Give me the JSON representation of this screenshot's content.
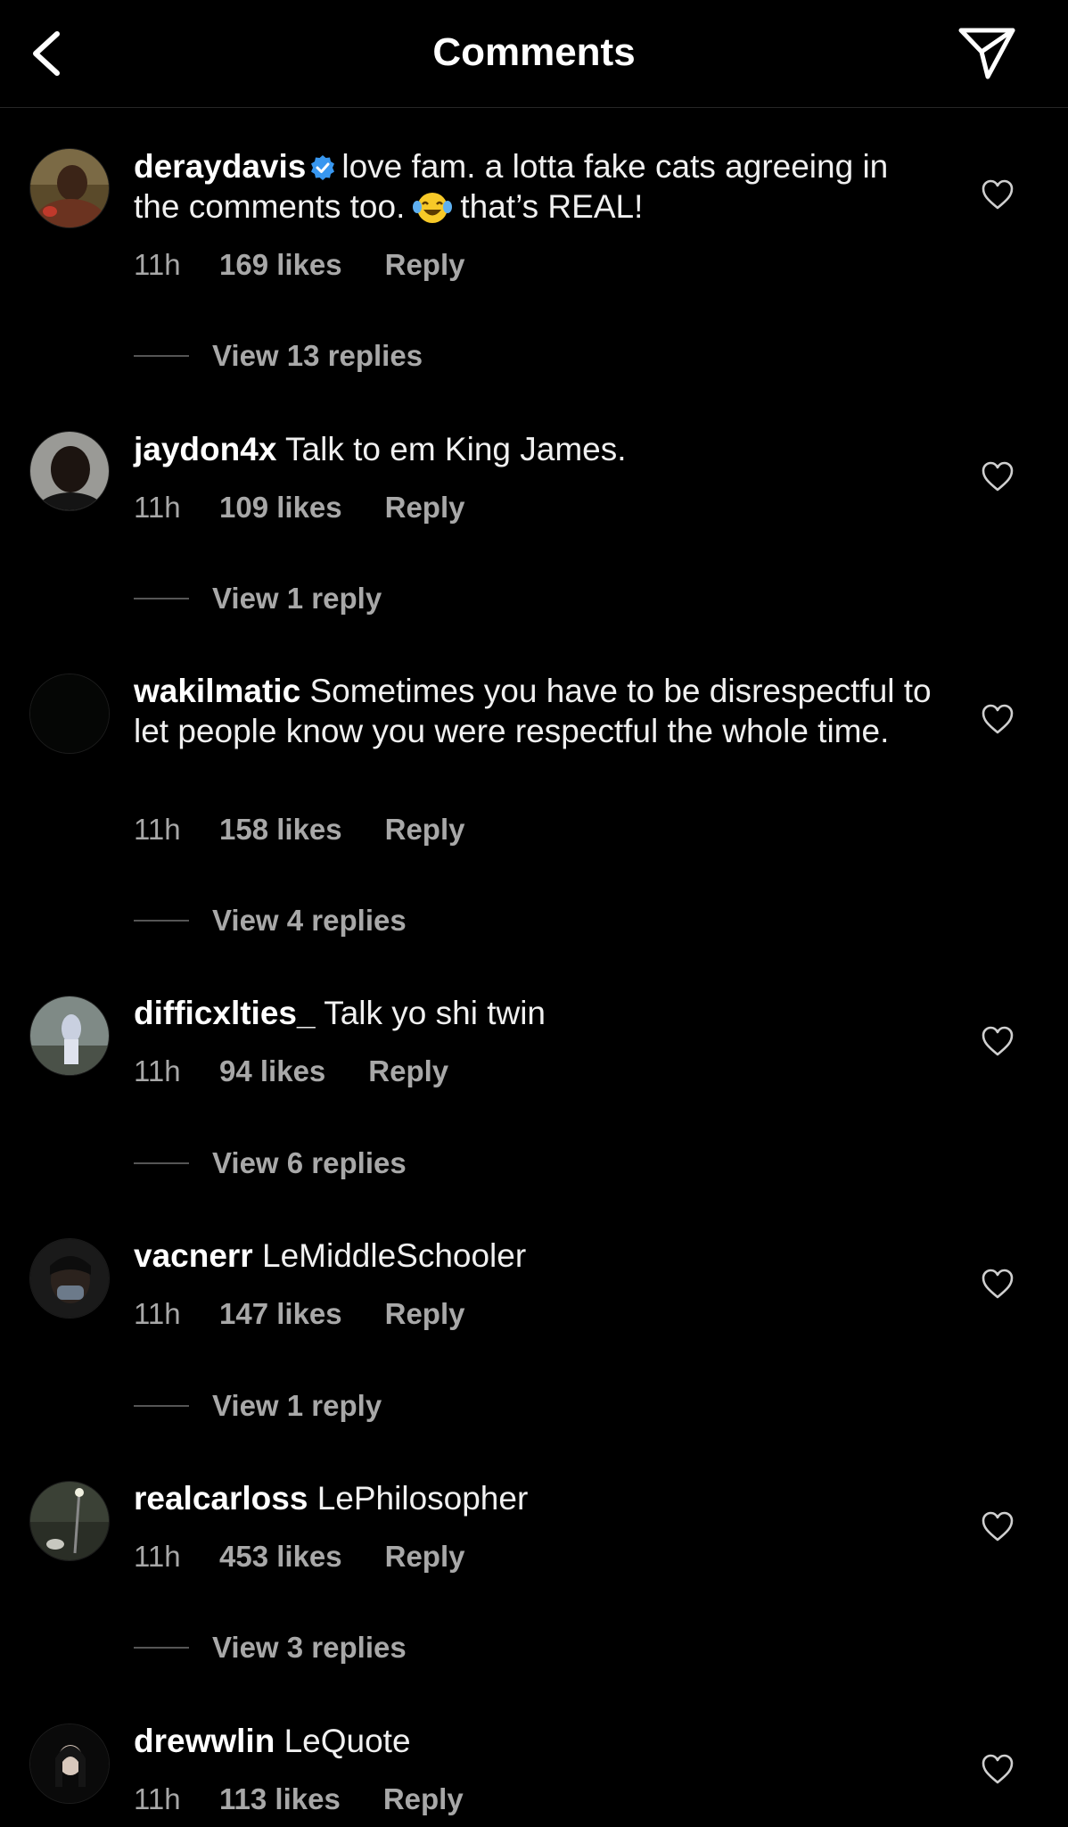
{
  "header": {
    "title": "Comments",
    "back_icon": "chevron-left-icon",
    "share_icon": "paper-plane-icon"
  },
  "colors": {
    "background": "#000000",
    "text_primary": "#ffffff",
    "text_secondary": "#a8a8a8",
    "verified": "#3897f0"
  },
  "comments": [
    {
      "username": "deraydavis",
      "verified": true,
      "text_before_emoji": "love fam. a lotta fake cats agreeing in the comments too.",
      "emoji": "face-with-tears-of-joy",
      "text_after_emoji": "that’s REAL!",
      "time": "11h",
      "likes": "169 likes",
      "reply_label": "Reply",
      "view_replies": "View 13 replies"
    },
    {
      "username": "jaydon4x",
      "text": "Talk to em King James.",
      "time": "11h",
      "likes": "109 likes",
      "reply_label": "Reply",
      "view_replies": "View 1 reply"
    },
    {
      "username": "wakilmatic",
      "text": "Sometimes you have to be disrespectful to let people know you were respectful the whole time.",
      "time": "11h",
      "likes": "158 likes",
      "reply_label": "Reply",
      "view_replies": "View 4 replies"
    },
    {
      "username": "difficxlties_",
      "text": "Talk yo shi twin",
      "time": "11h",
      "likes": "94 likes",
      "reply_label": "Reply",
      "view_replies": "View 6 replies"
    },
    {
      "username": "vacnerr",
      "text": "LeMiddleSchooler",
      "time": "11h",
      "likes": "147 likes",
      "reply_label": "Reply",
      "view_replies": "View 1 reply"
    },
    {
      "username": "realcarloss",
      "text": "LePhilosopher",
      "time": "11h",
      "likes": "453 likes",
      "reply_label": "Reply",
      "view_replies": "View 3 replies"
    },
    {
      "username": "drewwlin",
      "text": "LeQuote",
      "time": "11h",
      "likes": "113 likes",
      "reply_label": "Reply"
    }
  ]
}
